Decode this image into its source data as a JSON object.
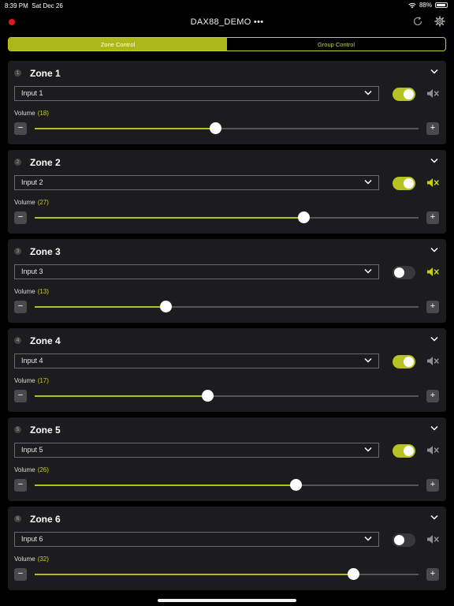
{
  "status": {
    "time": "8:39 PM",
    "date": "Sat Dec 26",
    "battery": "88%"
  },
  "app": {
    "title": "DAX88_DEMO •••"
  },
  "tabs": {
    "zone": "Zone Control",
    "group": "Group Control"
  },
  "labels": {
    "volume": "Volume",
    "minus": "−",
    "plus": "+"
  },
  "colors": {
    "accent": "#c5ce1e",
    "record": "#e0191e",
    "card": "#1c1c1e"
  },
  "zones": [
    {
      "num": "1",
      "name": "Zone 1",
      "input": "Input 1",
      "power": true,
      "muted": false,
      "volume": 18,
      "volume_text": "(18)",
      "level": 0.47
    },
    {
      "num": "2",
      "name": "Zone 2",
      "input": "Input 2",
      "power": true,
      "muted": true,
      "volume": 27,
      "volume_text": "(27)",
      "level": 0.7
    },
    {
      "num": "3",
      "name": "Zone 3",
      "input": "Input 3",
      "power": false,
      "muted": true,
      "volume": 13,
      "volume_text": "(13)",
      "level": 0.34
    },
    {
      "num": "4",
      "name": "Zone 4",
      "input": "Input 4",
      "power": true,
      "muted": false,
      "volume": 17,
      "volume_text": "(17)",
      "level": 0.45
    },
    {
      "num": "5",
      "name": "Zone 5",
      "input": "Input 5",
      "power": true,
      "muted": false,
      "volume": 26,
      "volume_text": "(26)",
      "level": 0.68
    },
    {
      "num": "6",
      "name": "Zone 6",
      "input": "Input 6",
      "power": false,
      "muted": false,
      "volume": 32,
      "volume_text": "(32)",
      "level": 0.83
    }
  ]
}
